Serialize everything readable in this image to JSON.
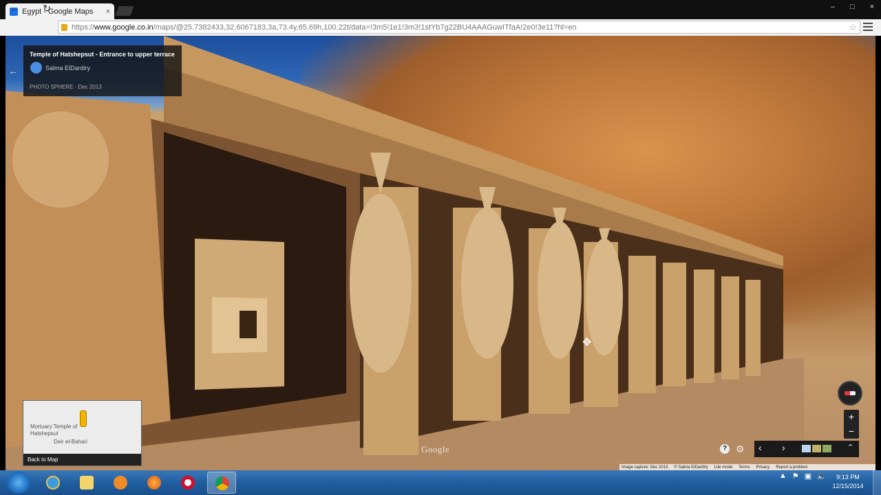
{
  "browser": {
    "tab_title": "Egypt - Google Maps",
    "tab_close": "×",
    "url_prefix": "https://",
    "url_host": "www.google.co.in",
    "url_path": "/maps/@25.7382433,32.6067183,3a,73.4y,65.69h,100.22t/data=!3m5!1e1!3m3!1stYb7g22BU4AAAGuwITfaA!2e0!3e11?hl=en",
    "window_controls": [
      "–",
      "□",
      "×"
    ],
    "nav": {
      "back": "←",
      "forward": "→",
      "reload": "↻"
    },
    "star": "☆"
  },
  "panorama": {
    "title": "Temple of Hatshepsut - Entrance to upper terrace",
    "author": "Salma ElDardiry",
    "meta": "PHOTO SPHERE · Dec 2013",
    "back_icon": "←"
  },
  "minimap": {
    "place_label": "Mortuary Temple of Hatshepsut",
    "area_label": "Deir el-Bahari",
    "back_to_map": "Back to Map"
  },
  "controls": {
    "zoom_in": "+",
    "zoom_out": "−",
    "help": "?",
    "prev": "‹",
    "next": "›",
    "expand": "⌃",
    "google_logo": "Google"
  },
  "attribution": [
    "Image capture: Dec 2013",
    "© Salma ElDardiry",
    "Lite mode",
    "Terms",
    "Privacy",
    "Report a problem"
  ],
  "taskbar": {
    "apps": [
      "start",
      "ie",
      "explorer",
      "media-player",
      "firefox",
      "opera",
      "chrome"
    ],
    "time": "9:13 PM",
    "date": "12/15/2014"
  },
  "colors": {
    "sky": "#1c4e9c",
    "sandstone": "#b98245",
    "taskbar": "#1f5ea0",
    "pin": "#f4b400"
  }
}
